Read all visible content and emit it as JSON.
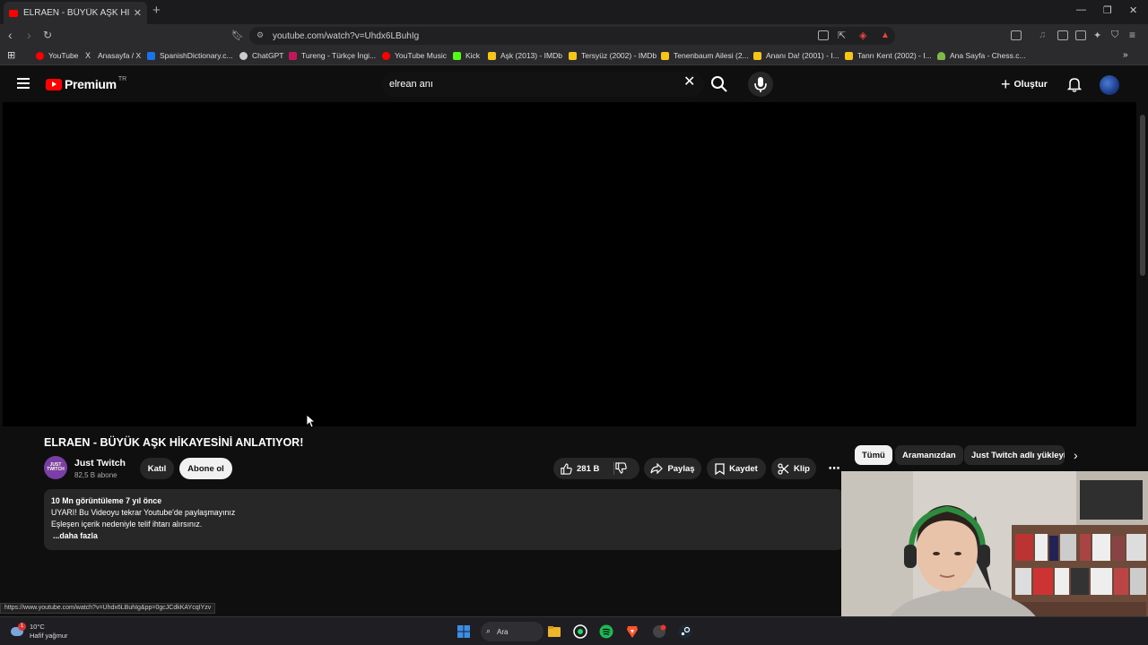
{
  "browser": {
    "tab_title": "ELRAEN - BÜYÜK AŞK HİKAYESİNİ",
    "url": "youtube.com/watch?v=Uhdx6LBuhIg",
    "bookmarks": [
      {
        "label": "YouTube",
        "color": "#ff0000"
      },
      {
        "label": "Anasayfa / X",
        "color": "#dddddd"
      },
      {
        "label": "SpanishDictionary.c...",
        "color": "#1a73e8"
      },
      {
        "label": "ChatGPT",
        "color": "#cccccc"
      },
      {
        "label": "Tureng - Türkçe İngi...",
        "color": "#c2185b"
      },
      {
        "label": "YouTube Music",
        "color": "#ff0000"
      },
      {
        "label": "Kick",
        "color": "#53fc18"
      },
      {
        "label": "Aşk (2013) - IMDb",
        "color": "#f5c518"
      },
      {
        "label": "Tersyüz (2002) - IMDb",
        "color": "#f5c518"
      },
      {
        "label": "Tenenbaum Ailesi (2...",
        "color": "#f5c518"
      },
      {
        "label": "Ananı Da! (2001) - I...",
        "color": "#f5c518"
      },
      {
        "label": "Tanrı Kent (2002) - I...",
        "color": "#f5c518"
      },
      {
        "label": "Ana Sayfa - Chess.c...",
        "color": "#81b64c"
      }
    ],
    "status_url": "https://www.youtube.com/watch?v=Uhdx6LBuhIg&pp=0gcJCdkKAYcqIYzv"
  },
  "youtube": {
    "logo_text": "Premium",
    "logo_region": "TR",
    "search_query": "elrean anı",
    "create_label": "Oluştur"
  },
  "video": {
    "title": "ELRAEN - BÜYÜK AŞK HİKAYESİNİ ANLATIYOR!",
    "channel_name": "Just Twitch",
    "channel_avatar_text": "JUST TWITCH",
    "subscribers": "82,5 B abone",
    "join_label": "Katıl",
    "subscribe_label": "Abone ol",
    "likes": "281 B",
    "share_label": "Paylaş",
    "save_label": "Kaydet",
    "clip_label": "Klip",
    "more_label": "⋯"
  },
  "description": {
    "meta": "10 Mn görüntüleme  7 yıl önce",
    "line1": "UYARI! Bu Videoyu tekrar Youtube'de paylaşmayınız",
    "line2": "Eşleşen içerik nedeniyle telif ihtarı alırsınız.",
    "more": "...daha fazla"
  },
  "chips": {
    "all": "Tümü",
    "from_search": "Aramanızdan",
    "uploader": "Just Twitch adlı yükleyici"
  },
  "taskbar": {
    "temperature": "10°C",
    "weather": "Hafif yağmur",
    "notification_count": "1",
    "search_label": "Ara"
  }
}
